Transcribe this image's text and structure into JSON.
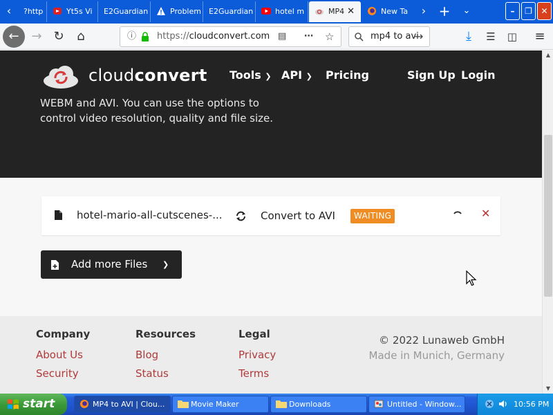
{
  "browser": {
    "tabs": [
      {
        "label": "?http",
        "icon": "blank-page-icon"
      },
      {
        "label": "Yt5s Vi",
        "icon": "yt5s-icon"
      },
      {
        "label": "E2Guardian",
        "icon": "none"
      },
      {
        "label": "Problem",
        "icon": "warning-icon"
      },
      {
        "label": "E2Guardian",
        "icon": "none"
      },
      {
        "label": "hotel m",
        "icon": "youtube-icon"
      },
      {
        "label": "MP4",
        "icon": "cloudconvert-icon"
      },
      {
        "label": "New Ta",
        "icon": "firefox-icon"
      }
    ],
    "url_prefix": "https://",
    "url_domain": "cloudconvert.com",
    "search_text": "mp4 to avi"
  },
  "site": {
    "logo_light": "cloud",
    "logo_bold": "convert",
    "nav": {
      "tools": "Tools",
      "api": "API",
      "pricing": "Pricing",
      "signup": "Sign Up",
      "login": "Login"
    },
    "hero_line1": "WEBM and AVI. You can use the options to",
    "hero_line2": "control video resolution, quality and file size."
  },
  "file": {
    "name": "hotel-mario-all-cutscenes-...",
    "convert_label": "Convert to AVI",
    "status": "WAITING"
  },
  "add_more_label": "Add more Files",
  "footer": {
    "company": {
      "heading": "Company",
      "links": [
        "About Us",
        "Security"
      ]
    },
    "resources": {
      "heading": "Resources",
      "links": [
        "Blog",
        "Status"
      ]
    },
    "legal": {
      "heading": "Legal",
      "links": [
        "Privacy",
        "Terms"
      ]
    },
    "copyright": "© 2022 Lunaweb GmbH",
    "made_in": "Made in Munich, Germany"
  },
  "taskbar": {
    "start": "start",
    "tasks": [
      "MP4 to AVI | Clou...",
      "Movie Maker",
      "Downloads",
      "Untitled - Window..."
    ],
    "clock": "10:56 PM"
  },
  "colors": {
    "accent_red": "#b03a3a",
    "status_orange": "#f08c24",
    "hero_bg": "#232323",
    "tabbar_blue": "#0c5bd8"
  }
}
